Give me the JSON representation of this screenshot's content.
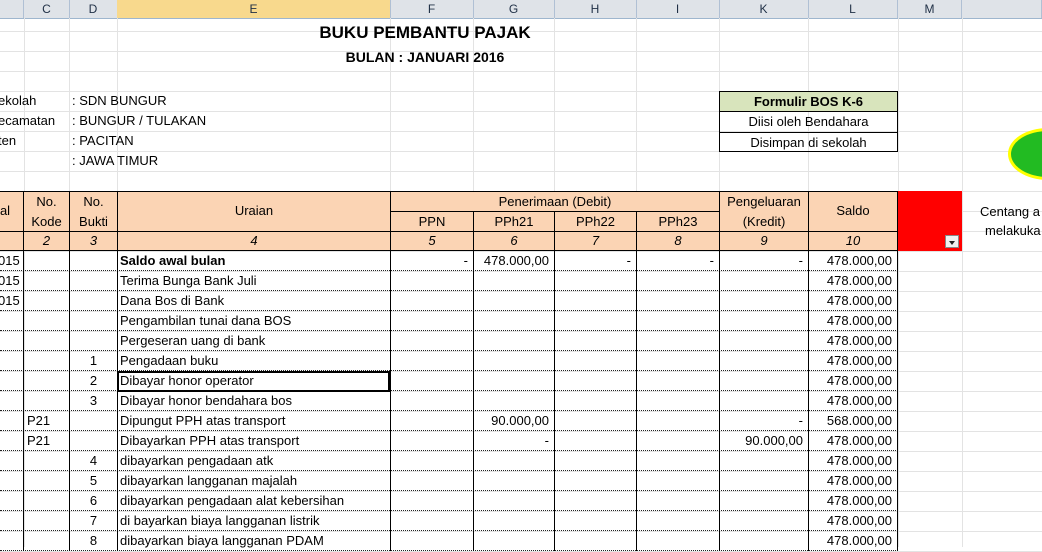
{
  "columns": [
    {
      "id": "c",
      "label": "C"
    },
    {
      "id": "d",
      "label": "D"
    },
    {
      "id": "e",
      "label": "E"
    },
    {
      "id": "f",
      "label": "F"
    },
    {
      "id": "g",
      "label": "G"
    },
    {
      "id": "h",
      "label": "H"
    },
    {
      "id": "i",
      "label": "I"
    },
    {
      "id": "k",
      "label": "K"
    },
    {
      "id": "l",
      "label": "L"
    },
    {
      "id": "m",
      "label": "M"
    }
  ],
  "title": "BUKU PEMBANTU PAJAK",
  "subtitle": "BULAN :  JANUARI 2016",
  "info": [
    {
      "label": "ekolah",
      "value": ":  SDN BUNGUR"
    },
    {
      "label": "ecamatan",
      "value": ":  BUNGUR / TULAKAN"
    },
    {
      "label": "ten",
      "value": ":  PACITAN"
    },
    {
      "label": "",
      "value": ":  JAWA TIMUR"
    }
  ],
  "form_box": {
    "title": "Formulir BOS K-6",
    "line1": "Diisi oleh Bendahara",
    "line2": "Disimpan di sekolah"
  },
  "header": {
    "col_b": "al",
    "no_kode": "No.\nKode",
    "no_bukti": "No.\nBukti",
    "uraian": "Uraian",
    "penerimaan": "Penerimaan (Debit)",
    "ppn": "PPN",
    "pph21": "PPh21",
    "pph22": "PPh22",
    "pph23": "PPh23",
    "pengeluaran_1": "Pengeluaran",
    "pengeluaran_2": "(Kredit)",
    "saldo": "Saldo",
    "nums": [
      "2",
      "3",
      "4",
      "5",
      "6",
      "7",
      "8",
      "9",
      "10"
    ]
  },
  "side_note": {
    "line1": "Centang a",
    "line2": "melakuka"
  },
  "rows": [
    {
      "a": "015",
      "kode": "",
      "bukti": "",
      "uraian": "Saldo awal bulan",
      "bold": true,
      "ppn": "-",
      "pph21": "478.000,00",
      "pph22": "-",
      "pph23": "-",
      "kredit": "-",
      "saldo": "478.000,00"
    },
    {
      "a": "015",
      "kode": "",
      "bukti": "",
      "uraian": "Terima Bunga Bank Juli",
      "ppn": "",
      "pph21": "",
      "pph22": "",
      "pph23": "",
      "kredit": "",
      "saldo": "478.000,00"
    },
    {
      "a": "015",
      "kode": "",
      "bukti": "",
      "uraian": "Dana Bos di Bank",
      "ppn": "",
      "pph21": "",
      "pph22": "",
      "pph23": "",
      "kredit": "",
      "saldo": "478.000,00"
    },
    {
      "a": "",
      "kode": "",
      "bukti": "",
      "uraian": "Pengambilan tunai dana BOS",
      "ppn": "",
      "pph21": "",
      "pph22": "",
      "pph23": "",
      "kredit": "",
      "saldo": "478.000,00"
    },
    {
      "a": "",
      "kode": "",
      "bukti": "",
      "uraian": "Pergeseran uang di bank",
      "ppn": "",
      "pph21": "",
      "pph22": "",
      "pph23": "",
      "kredit": "",
      "saldo": "478.000,00"
    },
    {
      "a": "",
      "kode": "",
      "bukti": "1",
      "uraian": "Pengadaan buku",
      "ppn": "",
      "pph21": "",
      "pph22": "",
      "pph23": "",
      "kredit": "",
      "saldo": "478.000,00"
    },
    {
      "a": "",
      "kode": "",
      "bukti": "2",
      "uraian": "Dibayar honor operator",
      "selected": true,
      "ppn": "",
      "pph21": "",
      "pph22": "",
      "pph23": "",
      "kredit": "",
      "saldo": "478.000,00"
    },
    {
      "a": "",
      "kode": "",
      "bukti": "3",
      "uraian": "Dibayar honor bendahara bos",
      "ppn": "",
      "pph21": "",
      "pph22": "",
      "pph23": "",
      "kredit": "",
      "saldo": "478.000,00"
    },
    {
      "a": "",
      "kode": "P21",
      "bukti": "",
      "uraian": "Dipungut PPH atas transport",
      "ppn": "",
      "pph21": "90.000,00",
      "pph22": "",
      "pph23": "",
      "kredit": "-",
      "saldo": "568.000,00"
    },
    {
      "a": "",
      "kode": "P21",
      "bukti": "",
      "uraian": "Dibayarkan PPH atas transport",
      "ppn": "",
      "pph21": "-",
      "pph22": "",
      "pph23": "",
      "kredit": "90.000,00",
      "saldo": "478.000,00"
    },
    {
      "a": "",
      "kode": "",
      "bukti": "4",
      "uraian": "dibayarkan pengadaan atk",
      "ppn": "",
      "pph21": "",
      "pph22": "",
      "pph23": "",
      "kredit": "",
      "saldo": "478.000,00"
    },
    {
      "a": "",
      "kode": "",
      "bukti": "5",
      "uraian": "dibayarkan langganan majalah",
      "ppn": "",
      "pph21": "",
      "pph22": "",
      "pph23": "",
      "kredit": "",
      "saldo": "478.000,00"
    },
    {
      "a": "",
      "kode": "",
      "bukti": "6",
      "uraian": "dibayarkan pengadaan alat kebersihan",
      "ppn": "",
      "pph21": "",
      "pph22": "",
      "pph23": "",
      "kredit": "",
      "saldo": "478.000,00"
    },
    {
      "a": "",
      "kode": "",
      "bukti": "7",
      "uraian": "di bayarkan biaya langganan listrik",
      "ppn": "",
      "pph21": "",
      "pph22": "",
      "pph23": "",
      "kredit": "",
      "saldo": "478.000,00"
    },
    {
      "a": "",
      "kode": "",
      "bukti": "8",
      "uraian": "dibayarkan biaya langganan PDAM",
      "ppn": "",
      "pph21": "",
      "pph22": "",
      "pph23": "",
      "kredit": "",
      "saldo": "478.000,00"
    }
  ],
  "colors": {
    "header_fill": "#fbd4b4",
    "form_title_fill": "#d8e4bc",
    "red_cell": "#ff0000",
    "green_shape": "#22bb22",
    "col_header_bg": "#dfe3e8"
  }
}
